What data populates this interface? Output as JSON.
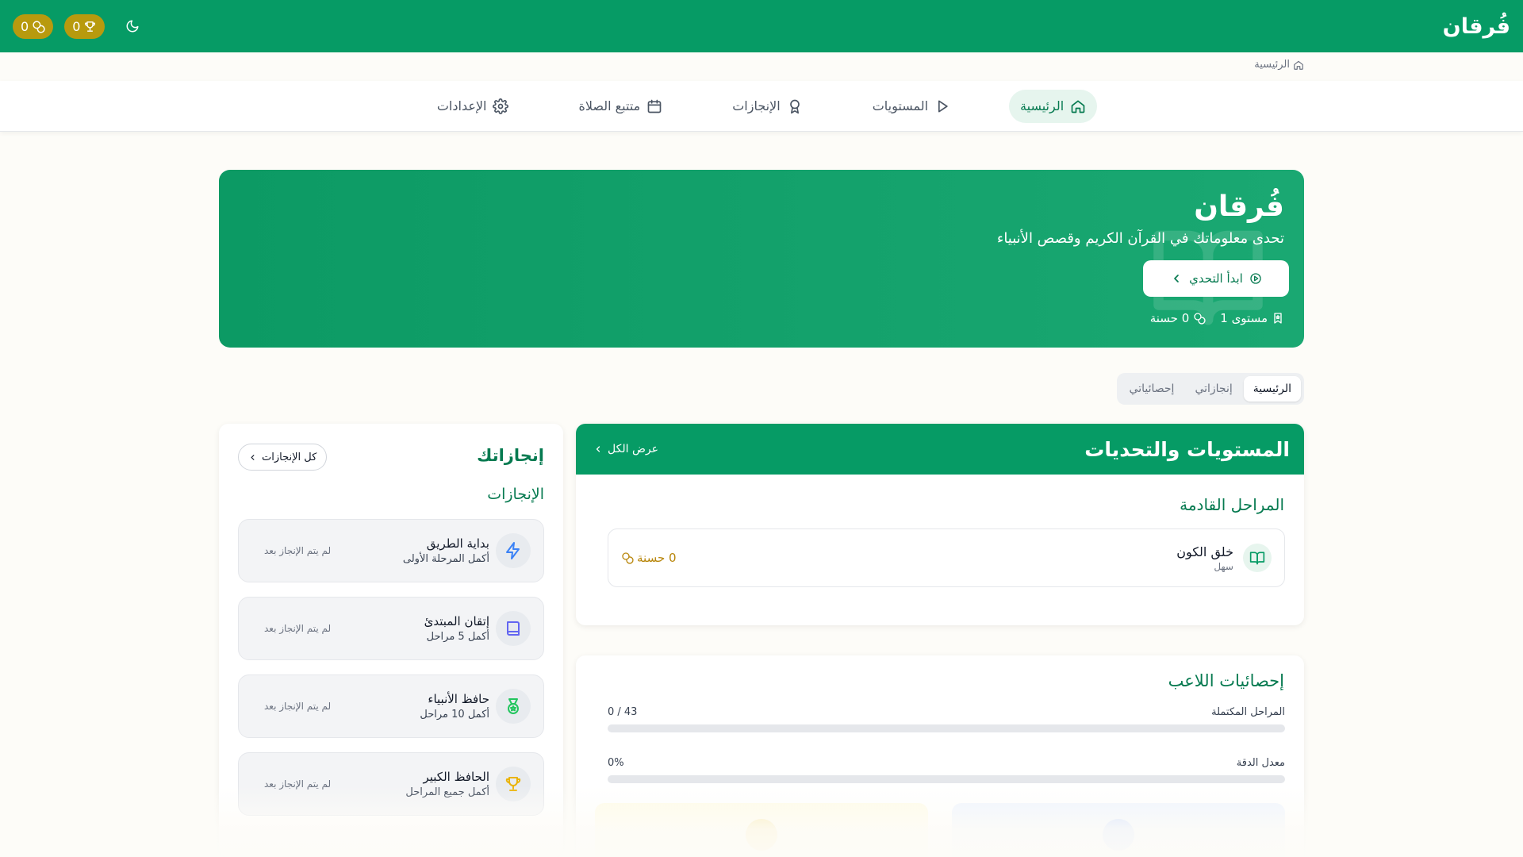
{
  "topbar": {
    "brand": "فُرقان",
    "points_count": "0",
    "trophies_count": "0",
    "colors": {
      "primary": "#069b65",
      "pill": "#b89a0e"
    }
  },
  "breadcrumb": {
    "home": "الرئيسية"
  },
  "nav": {
    "items": [
      {
        "label": "الرئيسية",
        "icon": "home-icon",
        "active": true
      },
      {
        "label": "المستويات",
        "icon": "play-icon"
      },
      {
        "label": "الإنجازات",
        "icon": "award-icon"
      },
      {
        "label": "متتبع الصلاة",
        "icon": "calendar-icon"
      },
      {
        "label": "الإعدادات",
        "icon": "gear-icon"
      }
    ]
  },
  "hero": {
    "title": "فُرقان",
    "subtitle": "تحدى معلوماتك في القرآن الكريم وقصص الأنبياء",
    "cta": "ابدأ التحدي",
    "level": "مستوى 1",
    "points": "0 حسنة"
  },
  "tabs": [
    {
      "label": "الرئيسية",
      "active": true
    },
    {
      "label": "إنجازاتي"
    },
    {
      "label": "إحصائياتي"
    }
  ],
  "levels": {
    "title": "المستويات والتحديات",
    "view_all": "عرض الكل",
    "upcoming_title": "المراحل القادمة",
    "stage": {
      "name": "خلق الكون",
      "difficulty": "سهل",
      "points": "0 حسنة"
    }
  },
  "stats": {
    "title": "إحصائيات اللاعب",
    "completed_label": "المراحل المكتملة",
    "completed_value": "0 / 43",
    "completed_fraction": 0,
    "accuracy_label": "معدل الدقة",
    "accuracy_value": "0%",
    "accuracy_fraction": 0
  },
  "achievements": {
    "title": "إنجازاتك",
    "all_button": "كل الإنجازات",
    "subtitle": "الإنجازات",
    "items": [
      {
        "name": "بداية الطريق",
        "desc": "أكمل المرحلة الأولى",
        "status": "لم يتم الإنجاز بعد",
        "icon": "lightning-icon",
        "color": "#3b82f6"
      },
      {
        "name": "إتقان المبتدئ",
        "desc": "أكمل 5 مراحل",
        "status": "لم يتم الإنجاز بعد",
        "icon": "book-icon",
        "color": "#6366f1"
      },
      {
        "name": "حافظ الأنبياء",
        "desc": "أكمل 10 مراحل",
        "status": "لم يتم الإنجاز بعد",
        "icon": "medal-icon",
        "color": "#22c55e"
      },
      {
        "name": "الحافظ الكبير",
        "desc": "أكمل جميع المراحل",
        "status": "لم يتم الإنجاز بعد",
        "icon": "trophy-icon",
        "color": "#eab308"
      }
    ]
  }
}
